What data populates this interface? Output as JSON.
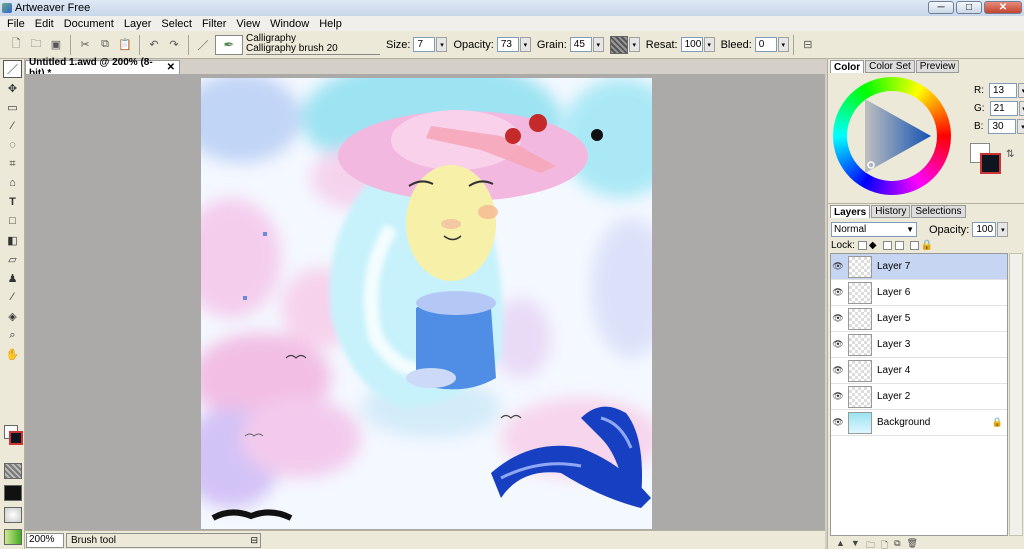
{
  "window": {
    "title": "Artweaver Free",
    "minimize": "─",
    "maximize": "□",
    "close": "✕"
  },
  "menu": [
    "File",
    "Edit",
    "Document",
    "Layer",
    "Select",
    "Filter",
    "View",
    "Window",
    "Help"
  ],
  "toolbar": {
    "brush_category": "Calligraphy",
    "brush_name": "Calligraphy brush 20",
    "size_label": "Size:",
    "size_value": "7",
    "opacity_label": "Opacity:",
    "opacity_value": "73",
    "grain_label": "Grain:",
    "grain_value": "45",
    "resat_label": "Resat:",
    "resat_value": "100",
    "bleed_label": "Bleed:",
    "bleed_value": "0"
  },
  "document": {
    "tab_title": "Untitled 1.awd @ 200% (8-bit) *",
    "close": "✕"
  },
  "status": {
    "zoom": "200%",
    "tool": "Brush tool"
  },
  "color_panel": {
    "tabs": [
      "Color",
      "Color Set",
      "Preview"
    ],
    "r_label": "R:",
    "r": "13",
    "g_label": "G:",
    "g": "21",
    "b_label": "B:",
    "b": "30",
    "foreground": "#0d151e",
    "background": "#ffffff"
  },
  "layers_panel": {
    "tabs": [
      "Layers",
      "History",
      "Selections"
    ],
    "blend_mode": "Normal",
    "opacity_label": "Opacity:",
    "opacity": "100",
    "lock_label": "Lock:",
    "layers": [
      {
        "name": "Layer 7",
        "selected": true
      },
      {
        "name": "Layer 6",
        "selected": false
      },
      {
        "name": "Layer 5",
        "selected": false
      },
      {
        "name": "Layer 3",
        "selected": false
      },
      {
        "name": "Layer 4",
        "selected": false
      },
      {
        "name": "Layer 2",
        "selected": false
      },
      {
        "name": "Background",
        "selected": false,
        "locked": true
      }
    ]
  }
}
